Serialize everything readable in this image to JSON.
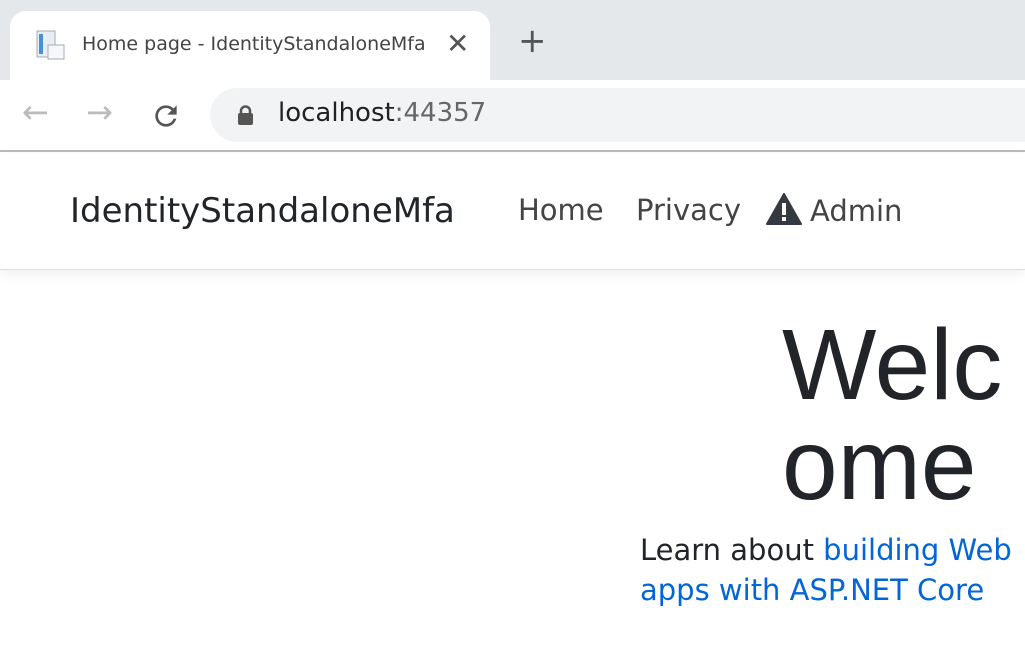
{
  "browser": {
    "tab_title": "Home page - IdentityStandaloneMfa",
    "url_host": "localhost",
    "url_port": ":44357"
  },
  "navbar": {
    "brand": "IdentityStandaloneMfa",
    "links": [
      "Home",
      "Privacy",
      "Admin"
    ]
  },
  "main": {
    "heading": "Welcome",
    "lead_text": "Learn about ",
    "link_text": "building Web apps with ASP.NET Core"
  }
}
